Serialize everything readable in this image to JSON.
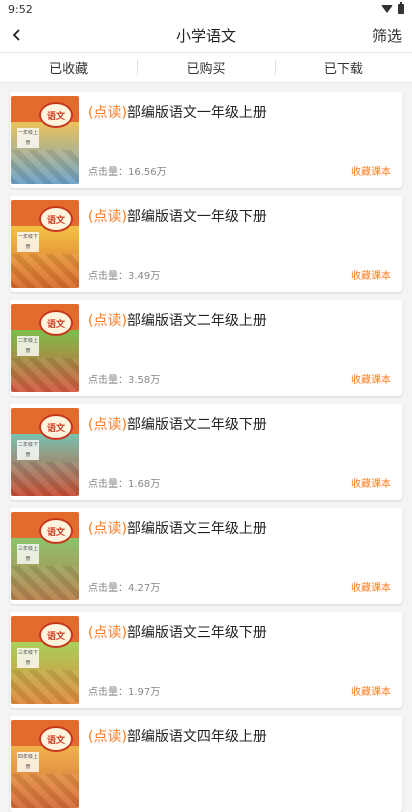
{
  "status": {
    "time": "9:52"
  },
  "header": {
    "title": "小学语文",
    "filter_label": "筛选"
  },
  "tabs": [
    "已收藏",
    "已购买",
    "已下载"
  ],
  "cover_title": "语文",
  "books": [
    {
      "tag": "(点读)",
      "title": "部编版语文一年级上册",
      "clicks": "点击量：16.56万",
      "action": "收藏课本",
      "cover_colors": [
        "#ecc35b",
        "#6ba1c9"
      ],
      "cover_label": "一年级上册"
    },
    {
      "tag": "(点读)",
      "title": "部编版语文一年级下册",
      "clicks": "点击量：3.49万",
      "action": "收藏课本",
      "cover_colors": [
        "#f3c244",
        "#d96a2f"
      ],
      "cover_label": "一年级下册"
    },
    {
      "tag": "(点读)",
      "title": "部编版语文二年级上册",
      "clicks": "点击量：3.58万",
      "action": "收藏课本",
      "cover_colors": [
        "#7bbf4a",
        "#d65942"
      ],
      "cover_label": "二年级上册"
    },
    {
      "tag": "(点读)",
      "title": "部编版语文二年级下册",
      "clicks": "点击量：1.68万",
      "action": "收藏课本",
      "cover_colors": [
        "#78c3b0",
        "#c84e32"
      ],
      "cover_label": "二年级下册"
    },
    {
      "tag": "(点读)",
      "title": "部编版语文三年级上册",
      "clicks": "点击量：4.27万",
      "action": "收藏课本",
      "cover_colors": [
        "#8bc36c",
        "#b8814e"
      ],
      "cover_label": "三年级上册"
    },
    {
      "tag": "(点读)",
      "title": "部编版语文三年级下册",
      "clicks": "点击量：1.97万",
      "action": "收藏课本",
      "cover_colors": [
        "#a8cf5a",
        "#e28a3c"
      ],
      "cover_label": "三年级下册"
    },
    {
      "tag": "(点读)",
      "title": "部编版语文四年级上册",
      "clicks": "",
      "action": "",
      "cover_colors": [
        "#efb24a",
        "#d66b3b"
      ],
      "cover_label": "四年级上册"
    }
  ]
}
